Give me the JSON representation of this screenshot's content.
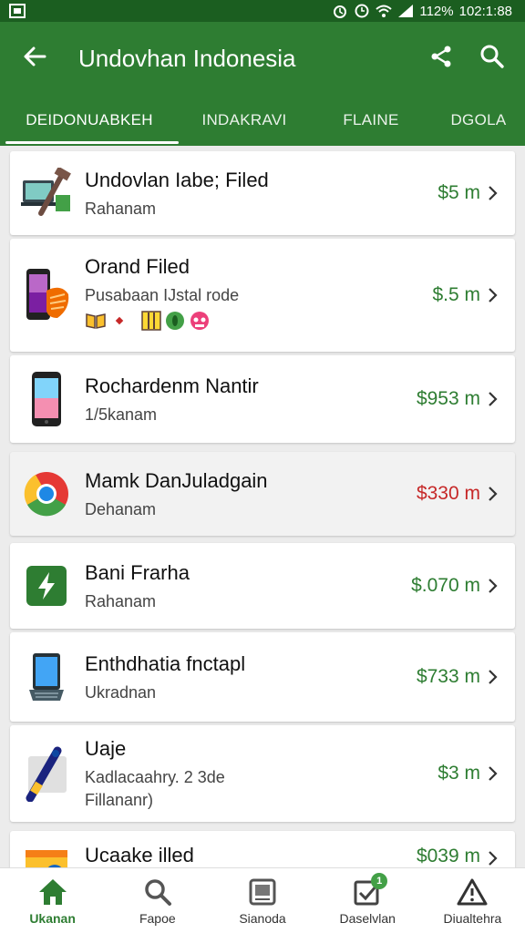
{
  "status_bar": {
    "battery_text": "112%",
    "time": "102:1:88"
  },
  "app_bar": {
    "title": "Undovhan Indonesia",
    "back_icon": "arrow-back-icon",
    "share_icon": "share-icon",
    "search_icon": "search-icon"
  },
  "tabs": [
    {
      "label": "DEIDONUABKEH",
      "active": true
    },
    {
      "label": "INDAKRAVI",
      "active": false
    },
    {
      "label": "FLAINE",
      "active": false
    },
    {
      "label": "DGOLA",
      "active": false
    }
  ],
  "items": [
    {
      "name": "Undovlan Iabe; Filed",
      "sub": "Rahanam",
      "price": "$5 m",
      "price_color": "#2e7d32",
      "icon": "laptop-hammer-icon"
    },
    {
      "name": "Orand Filed",
      "sub": "Pusabaan IJstal rode",
      "price": "$.5 m",
      "price_color": "#2e7d32",
      "icon": "phone-hand-icon"
    },
    {
      "name": "Rochardenm Nantir",
      "sub": "1/5kanam",
      "price": "$953 m",
      "price_color": "#2e7d32",
      "icon": "smartphone-icon"
    },
    {
      "name": "Mamk DanJuladgain",
      "sub": "Dehanam",
      "price": "$330 m",
      "price_color": "#c62828",
      "icon": "chrome-icon"
    },
    {
      "name": "Bani Frarha",
      "sub": "Rahanam",
      "price": "$.070 m",
      "price_color": "#2e7d32",
      "icon": "lightning-app-icon"
    },
    {
      "name": "Enthdhatia fnctapl",
      "sub": "Ukradnan",
      "price": "$733 m",
      "price_color": "#2e7d32",
      "icon": "tablet-icon"
    },
    {
      "name": "Uaje",
      "sub": "Kadlacaahry. 2 3de",
      "sub2": "Fillananr)",
      "price": "$3 m",
      "price_color": "#2e7d32",
      "icon": "stylus-icon"
    },
    {
      "name": "Ucaake illed",
      "sub": "",
      "price": "$039 m",
      "price_color": "#2e7d32",
      "icon": "box-icon"
    }
  ],
  "bottom_nav": [
    {
      "label": "Ukanan",
      "icon": "home-icon",
      "active": true
    },
    {
      "label": "Fapoe",
      "icon": "search-icon",
      "active": false
    },
    {
      "label": "Sianoda",
      "icon": "gallery-icon",
      "active": false
    },
    {
      "label": "Daselvlan",
      "icon": "checkbox-icon",
      "active": false,
      "badge": "1"
    },
    {
      "label": "Diualtehra",
      "icon": "warning-icon",
      "active": false
    }
  ]
}
